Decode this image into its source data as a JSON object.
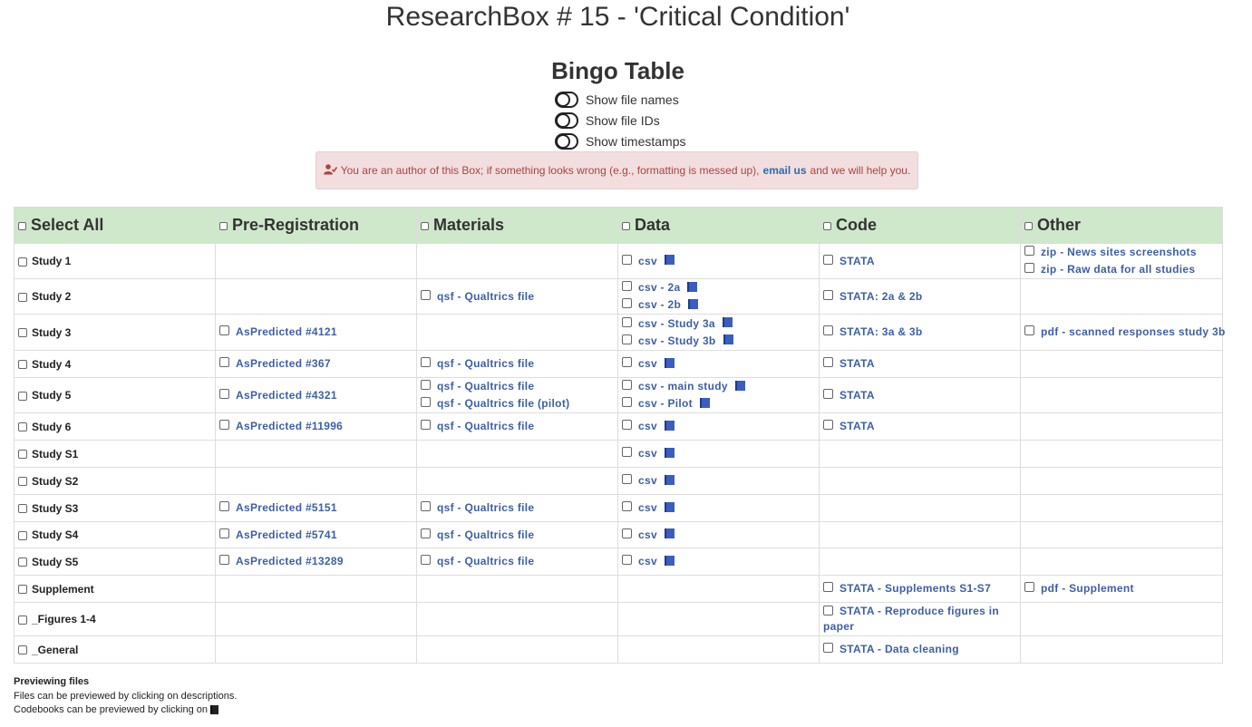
{
  "page_title": "ResearchBox # 15 - 'Critical Condition'",
  "bingo_title": "Bingo Table",
  "toggles": {
    "file_names": "Show file names",
    "file_ids": "Show file IDs",
    "timestamps": "Show timestamps"
  },
  "alert": {
    "before": "You are an author of this Box; if something looks wrong (e.g., formatting is messed up),",
    "link": "email us",
    "after": "and we will help you."
  },
  "columns": [
    "Select All",
    "Pre-Registration",
    "Materials",
    "Data",
    "Code",
    "Other"
  ],
  "rows": [
    {
      "label": "Study 1",
      "prereg": [],
      "materials": [],
      "data": [
        {
          "text": "csv",
          "codebook": true
        }
      ],
      "code": [
        {
          "text": "STATA"
        }
      ],
      "other": [
        {
          "text": "zip - News sites screenshots"
        },
        {
          "text": "zip - Raw data for all studies"
        }
      ]
    },
    {
      "label": "Study 2",
      "prereg": [],
      "materials": [
        {
          "text": "qsf - Qualtrics file"
        }
      ],
      "data": [
        {
          "text": "csv - 2a",
          "codebook": true
        },
        {
          "text": "csv - 2b",
          "codebook": true
        }
      ],
      "code": [
        {
          "text": "STATA: 2a & 2b"
        }
      ],
      "other": []
    },
    {
      "label": "Study 3",
      "prereg": [
        {
          "text": "AsPredicted #4121"
        }
      ],
      "materials": [],
      "data": [
        {
          "text": "csv - Study 3a",
          "codebook": true
        },
        {
          "text": "csv - Study 3b",
          "codebook": true
        }
      ],
      "code": [
        {
          "text": "STATA: 3a & 3b"
        }
      ],
      "other": [
        {
          "text": "pdf - scanned responses study 3b"
        }
      ]
    },
    {
      "label": "Study 4",
      "prereg": [
        {
          "text": "AsPredicted #367"
        }
      ],
      "materials": [
        {
          "text": "qsf - Qualtrics file"
        }
      ],
      "data": [
        {
          "text": "csv",
          "codebook": true
        }
      ],
      "code": [
        {
          "text": "STATA"
        }
      ],
      "other": []
    },
    {
      "label": "Study 5",
      "prereg": [
        {
          "text": "AsPredicted #4321"
        }
      ],
      "materials": [
        {
          "text": "qsf - Qualtrics file"
        },
        {
          "text": "qsf - Qualtrics file (pilot)"
        }
      ],
      "data": [
        {
          "text": "csv - main study",
          "codebook": true
        },
        {
          "text": "csv - Pilot",
          "codebook": true
        }
      ],
      "code": [
        {
          "text": "STATA"
        }
      ],
      "other": []
    },
    {
      "label": "Study 6",
      "prereg": [
        {
          "text": "AsPredicted #11996"
        }
      ],
      "materials": [
        {
          "text": "qsf - Qualtrics file"
        }
      ],
      "data": [
        {
          "text": "csv",
          "codebook": true
        }
      ],
      "code": [
        {
          "text": "STATA"
        }
      ],
      "other": []
    },
    {
      "label": "Study S1",
      "prereg": [],
      "materials": [],
      "data": [
        {
          "text": "csv",
          "codebook": true
        }
      ],
      "code": [],
      "other": []
    },
    {
      "label": "Study S2",
      "prereg": [],
      "materials": [],
      "data": [
        {
          "text": "csv",
          "codebook": true
        }
      ],
      "code": [],
      "other": []
    },
    {
      "label": "Study S3",
      "prereg": [
        {
          "text": "AsPredicted #5151"
        }
      ],
      "materials": [
        {
          "text": "qsf - Qualtrics file"
        }
      ],
      "data": [
        {
          "text": "csv",
          "codebook": true
        }
      ],
      "code": [],
      "other": []
    },
    {
      "label": "Study S4",
      "prereg": [
        {
          "text": "AsPredicted #5741"
        }
      ],
      "materials": [
        {
          "text": "qsf - Qualtrics file"
        }
      ],
      "data": [
        {
          "text": "csv",
          "codebook": true
        }
      ],
      "code": [],
      "other": []
    },
    {
      "label": "Study S5",
      "prereg": [
        {
          "text": "AsPredicted #13289"
        }
      ],
      "materials": [
        {
          "text": "qsf - Qualtrics file"
        }
      ],
      "data": [
        {
          "text": "csv",
          "codebook": true
        }
      ],
      "code": [],
      "other": []
    },
    {
      "label": "Supplement",
      "prereg": [],
      "materials": [],
      "data": [],
      "code": [
        {
          "text": "STATA - Supplements S1-S7"
        }
      ],
      "other": [
        {
          "text": "pdf - Supplement"
        }
      ]
    },
    {
      "label": "_Figures 1-4",
      "prereg": [],
      "materials": [],
      "data": [],
      "code": [
        {
          "text": "STATA - Reproduce figures in paper",
          "wrap": true
        }
      ],
      "other": []
    },
    {
      "label": "_General",
      "prereg": [],
      "materials": [],
      "data": [],
      "code": [
        {
          "text": "STATA - Data cleaning"
        }
      ],
      "other": []
    }
  ],
  "footer": {
    "heading": "Previewing files",
    "line1": "Files can be previewed by clicking on descriptions.",
    "line2": "Codebooks can be previewed by clicking on"
  },
  "colors": {
    "header_bg": "#cfe8cb",
    "link": "#3c5fa8",
    "alert_bg": "#f2dede",
    "alert_text": "#a94442",
    "codebook_icon": "#3a5ec0"
  }
}
